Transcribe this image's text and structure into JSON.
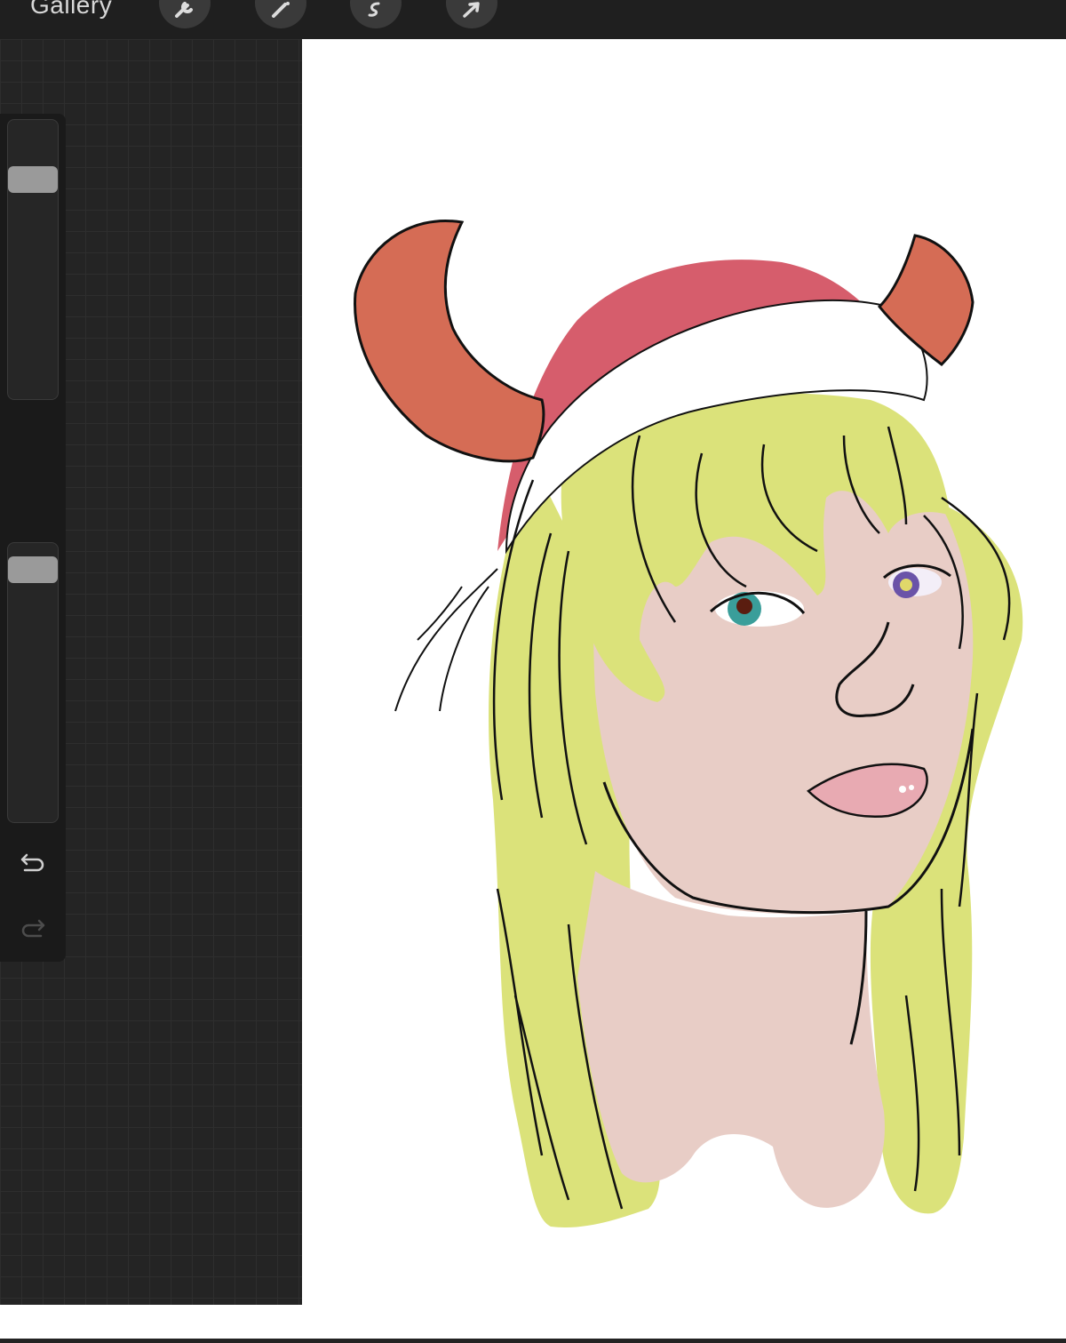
{
  "toolbar": {
    "gallery_label": "Gallery",
    "tools": [
      "wrench-icon",
      "magic-wand-icon",
      "selection-icon",
      "transform-arrow-icon"
    ]
  },
  "sidebar": {
    "brush_size_level": 0.82,
    "opacity_level": 0.95,
    "buttons": [
      "modify-button",
      "undo-icon",
      "redo-icon"
    ]
  },
  "colors": {
    "hair": "#dbe27a",
    "skin": "#e8cdc6",
    "hat": "#d65d6c",
    "horn": "#d56c55",
    "line": "#111111",
    "ui_dark": "#1a1a1a"
  }
}
